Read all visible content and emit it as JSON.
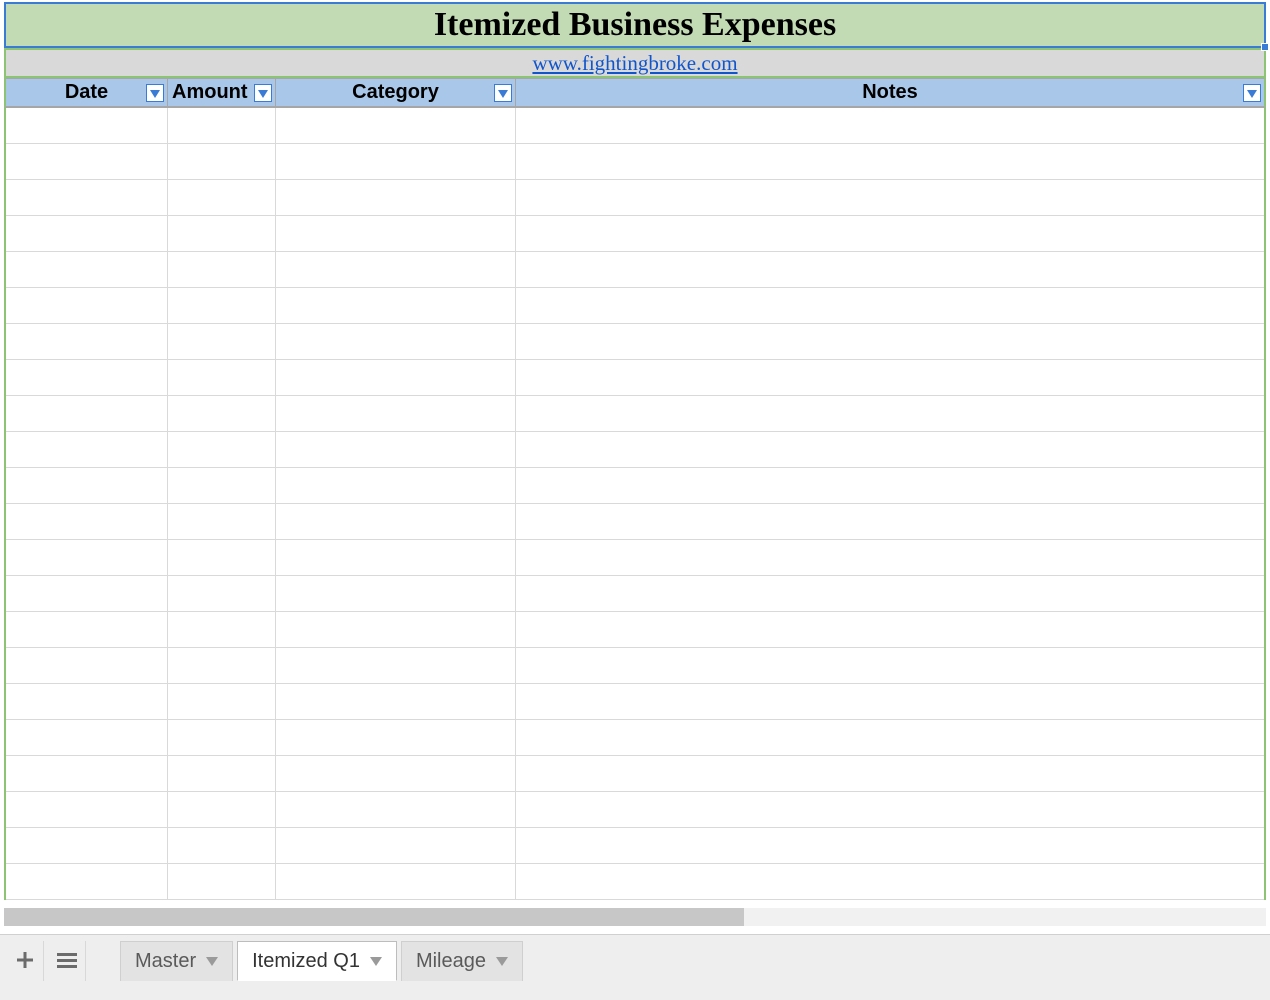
{
  "title": "Itemized Business Expenses",
  "link": {
    "text": "www.fightingbroke.com",
    "href": "#"
  },
  "columns": {
    "date": {
      "label": "Date"
    },
    "amount": {
      "label": "Amount"
    },
    "category": {
      "label": "Category"
    },
    "notes": {
      "label": "Notes"
    }
  },
  "row_count": 22,
  "tabs": {
    "master": {
      "label": "Master",
      "active": false
    },
    "itemized": {
      "label": "Itemized Q1",
      "active": true
    },
    "mileage": {
      "label": "Mileage",
      "active": false
    }
  },
  "colors": {
    "title_bg": "#c3dbb4",
    "selection_border": "#3a7bd5",
    "header_bg": "#a9c7e8",
    "green_border": "#8cc474",
    "link_row_bg": "#d9d9d9",
    "link_color": "#1155cc"
  }
}
